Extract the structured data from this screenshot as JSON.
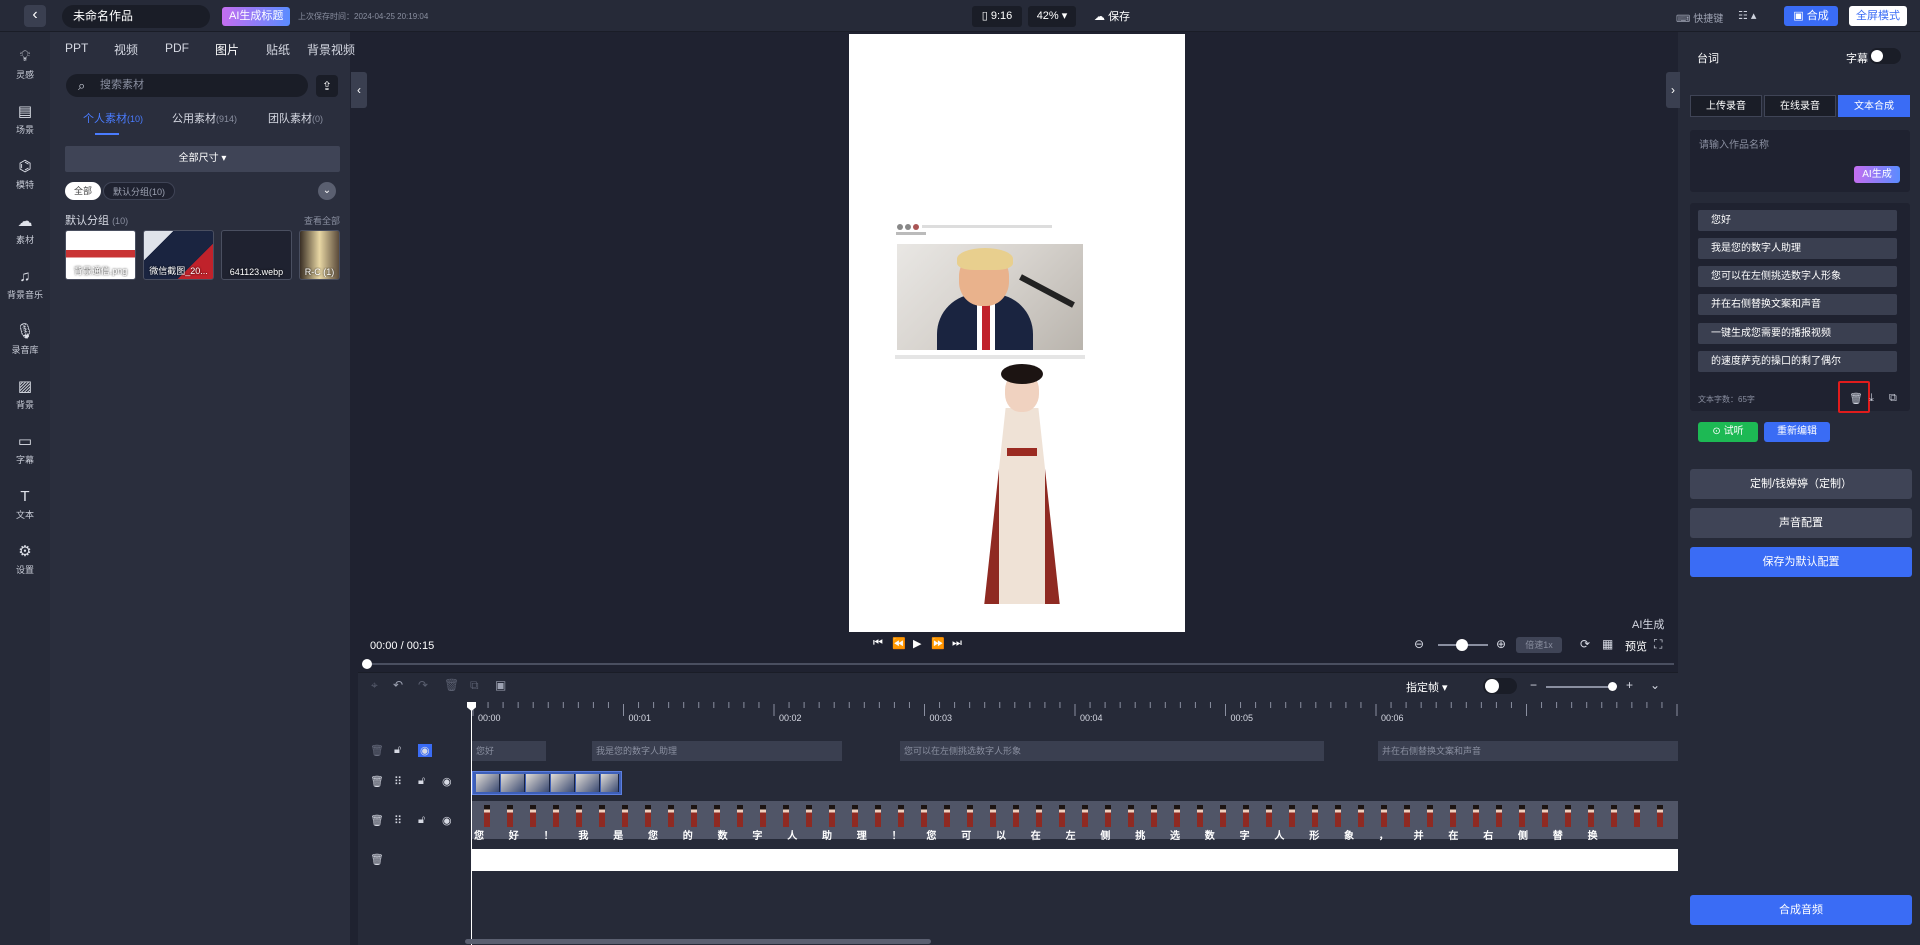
{
  "topbar": {
    "project_name": "未命名作品",
    "ai_title_button": "AI生成标题",
    "last_saved": "上次保存时间：2024-04-25 20:19:04",
    "aspect_ratio": "9:16",
    "zoom": "42%",
    "save_label": "保存",
    "shortcut_label": "快捷键",
    "compose_label": "合成",
    "full_mode_label": "全屏模式"
  },
  "leftnav": {
    "items": [
      {
        "label": "灵感",
        "icon": "lightbulb-icon"
      },
      {
        "label": "场景",
        "icon": "clapperboard-icon"
      },
      {
        "label": "模特",
        "icon": "robot-icon"
      },
      {
        "label": "素材",
        "icon": "cloud-icon"
      },
      {
        "label": "背景音乐",
        "icon": "music-icon"
      },
      {
        "label": "录音库",
        "icon": "microphone-icon"
      },
      {
        "label": "背景",
        "icon": "stripes-icon"
      },
      {
        "label": "字幕",
        "icon": "subtitle-icon"
      },
      {
        "label": "文本",
        "icon": "text-icon"
      },
      {
        "label": "设置",
        "icon": "gear-icon"
      }
    ]
  },
  "assets": {
    "tabs": [
      "PPT",
      "视频",
      "PDF",
      "图片",
      "贴纸",
      "背景视频"
    ],
    "active_tab": "图片",
    "search_placeholder": "搜索素材",
    "subtabs": [
      {
        "label": "个人素材",
        "count": "(10)"
      },
      {
        "label": "公用素材",
        "count": "(914)"
      },
      {
        "label": "团队素材",
        "count": "(0)"
      }
    ],
    "size_select": "全部尺寸",
    "chip_all": "全部",
    "chip_group": "默认分组(10)",
    "group_label": "默认分组",
    "group_count": "(10)",
    "view_all": "查看全部",
    "thumbnails": [
      "背景通信.png",
      "微信截图_20...",
      "641123.webp",
      "R-C (1)"
    ]
  },
  "stage": {
    "watermark": "AI生成",
    "time": "00:00 / 00:15",
    "speed": "倍速1x",
    "preview": "预览",
    "progress_fraction": 0
  },
  "timeline": {
    "keyframe_label": "指定帧",
    "ruler": [
      "00:00",
      "00:01",
      "00:02",
      "00:03",
      "00:04",
      "00:05",
      "00:06"
    ],
    "subtitle_segments": [
      "您好",
      "我是您的数字人助理",
      "您可以在左侧挑选数字人形象",
      "并在右侧替换文案和声音"
    ],
    "characters": [
      "您",
      "好",
      "！",
      "我",
      "是",
      "您",
      "的",
      "数",
      "字",
      "人",
      "助",
      "理",
      "！",
      "您",
      "可",
      "以",
      "在",
      "左",
      "侧",
      "挑",
      "选",
      "数",
      "字",
      "人",
      "形",
      "象",
      "，",
      "并",
      "在",
      "右",
      "侧",
      "替",
      "换"
    ]
  },
  "rightpanel": {
    "title": "台词",
    "subtitle_toggle_label": "字幕",
    "modes": [
      "上传录音",
      "在线录音",
      "文本合成"
    ],
    "active_mode": "文本合成",
    "name_placeholder": "请输入作品名称",
    "ai_generate": "AI生成",
    "lines": [
      "您好",
      "我是您的数字人助理",
      "您可以在左侧挑选数字人形象",
      "并在右侧替换文案和声音",
      "一键生成您需要的播报视频",
      "的速度萨克的操口的剩了偶尔"
    ],
    "word_count": "文本字数：65字",
    "listen": "试听",
    "reedit": "重新编辑",
    "voice_custom": "定制/钱婷婷（定制）",
    "voice_config": "声音配置",
    "save_default": "保存为默认配置",
    "synthesize_audio": "合成音频"
  },
  "colors": {
    "accent": "#3a6cf5",
    "listen_green": "#1db954",
    "highlight_red": "#e01c1c"
  }
}
